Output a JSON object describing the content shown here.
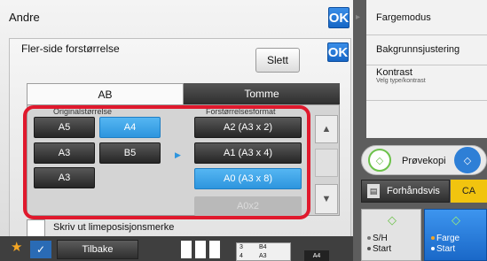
{
  "window": {
    "title": "Andre",
    "ok_top": "OK"
  },
  "dialog": {
    "title": "Fler-side forstørrelse",
    "ok": "OK",
    "slett": "Slett",
    "tabs": [
      {
        "label": "AB",
        "active": true
      },
      {
        "label": "Tomme",
        "active": false
      }
    ],
    "original_label": "Originalstørrelse",
    "forstorrelse_label": "Forstørrelsesformat",
    "original_sizes": [
      "A5",
      "A4",
      "A3",
      "B5",
      "A3"
    ],
    "original_selected": "A4",
    "formats": [
      "A2 (A3 x 2)",
      "A1 (A3 x 4)",
      "A0 (A3 x 8)",
      "A0x2"
    ],
    "format_selected": "A0 (A3 x 8)",
    "format_disabled": "A0x2",
    "checkbox_label": "Skriv ut limeposisjonsmerke",
    "checkbox_checked": false
  },
  "bottom": {
    "tilbake": "Tilbake",
    "size_table": [
      [
        "3",
        "B4"
      ],
      [
        "4",
        "A3"
      ]
    ],
    "size_badge": "A4"
  },
  "right_menu": {
    "items": [
      "Fargemodus",
      "Bakgrunnsjustering",
      "Kontrast"
    ],
    "kontrast_sub": "Velg type/kontrast"
  },
  "actions": {
    "provekopi": "Prøvekopi",
    "forhandsvis": "Forhåndsvis",
    "ca": "CA",
    "sh_line1": "S/H",
    "sh_line2": "Start",
    "farge_line1": "Farge",
    "farge_line2": "Start"
  },
  "colors": {
    "accent_blue": "#2d95de",
    "highlight_red": "#e0192d",
    "ok_blue": "#1767c6",
    "start_green": "#6cc24a",
    "ca_yellow": "#f1c40f"
  }
}
